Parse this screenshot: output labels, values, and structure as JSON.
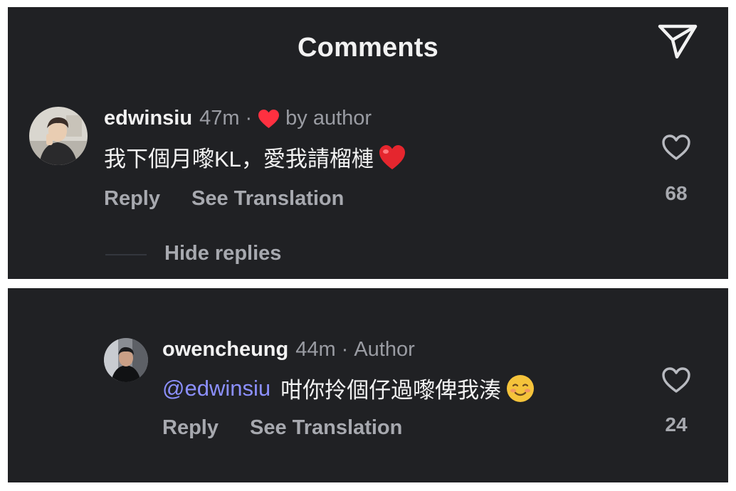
{
  "header": {
    "title": "Comments",
    "share_icon": "paper-plane-icon"
  },
  "comments": [
    {
      "username": "edwinsiu",
      "time": "47m",
      "separator": "·",
      "liked_by_author_label": "by author",
      "liked_by_author_icon": "heart-icon",
      "liked_by_author_color": "#ff3040",
      "text": "我下個月嚟KL，愛我請榴槤",
      "text_emoji": "red-heart-emoji",
      "reply_label": "Reply",
      "translate_label": "See Translation",
      "like_count": "68"
    }
  ],
  "hide_replies_label": "Hide replies",
  "replies": [
    {
      "username": "owencheung",
      "time": "44m",
      "separator": "·",
      "author_badge": "Author",
      "mention": "@edwinsiu",
      "text": "咁你拎個仔過嚟俾我湊",
      "text_emoji": "smiling-face-emoji",
      "reply_label": "Reply",
      "translate_label": "See Translation",
      "like_count": "24"
    }
  ],
  "colors": {
    "background": "#202124",
    "mention": "#8c90ff",
    "muted": "#a7a9af"
  }
}
